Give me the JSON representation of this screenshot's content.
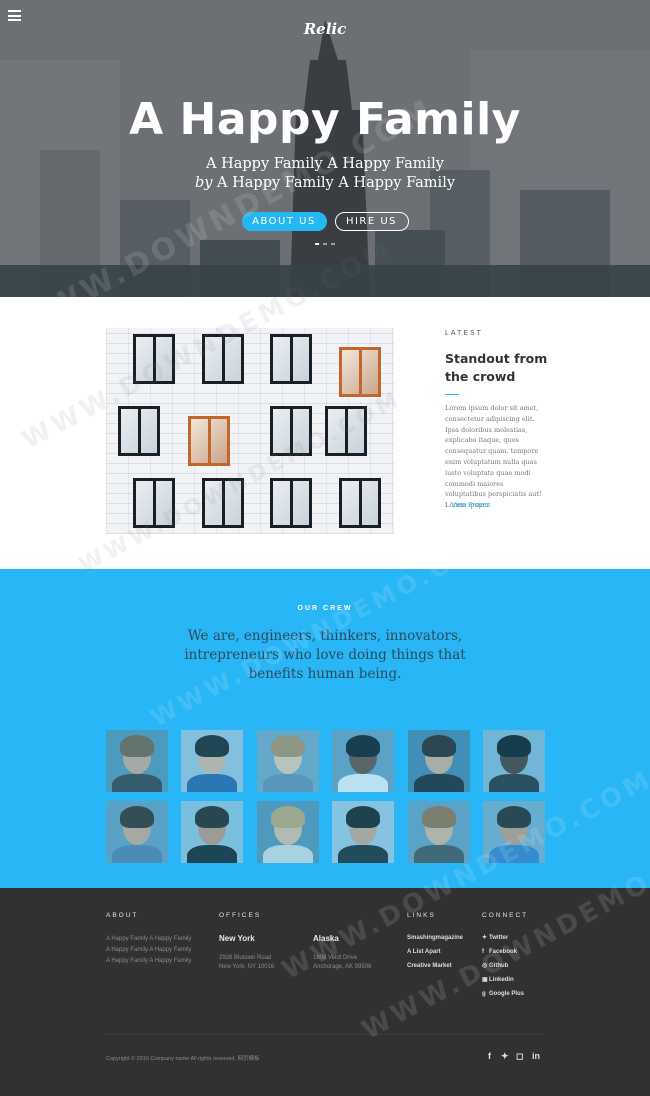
{
  "header": {
    "logo": "Relic",
    "menu_icon": "hamburger-menu-icon"
  },
  "hero": {
    "title": "A Happy Family",
    "subtitle_line1": "A Happy Family A Happy Family",
    "subtitle_line2_prefix": "by",
    "subtitle_line2": " A Happy Family A Happy Family",
    "primary_button": "ABOUT US",
    "secondary_button": "HIRE US"
  },
  "latest": {
    "kicker": "LATEST",
    "title": "Standout from the crowd",
    "body": "Lorem ipsum dolor sit amet, consectetur adipiscing elit. Ipsa doloribus molestias, explicabo itaque, quos consequatur quam. tempore enim voluptatum nulla quas iusto voluptate quae modi commodi maiores voluptatibus perspiciatis aut! Lorem ipsum.",
    "link": "View Project",
    "link_icon": "chevron-right-icon"
  },
  "crew": {
    "kicker": "OUR CREW",
    "text": "We are, engineers, thinkers, innovators, intrepreneurs who love doing things that benefits human being.",
    "members": [
      "member-1",
      "member-2",
      "member-3",
      "member-4",
      "member-5",
      "member-6",
      "member-7",
      "member-8",
      "member-9",
      "member-10",
      "member-11",
      "member-12"
    ]
  },
  "footer": {
    "about": {
      "heading": "ABOUT",
      "lines": [
        "A Happy Family A Happy Family",
        "A Happy Family A Happy Family",
        "A Happy Family A Happy Family"
      ]
    },
    "offices": {
      "heading": "OFFICES",
      "locations": [
        {
          "city": "New York",
          "line1": "2926 Blutown Road",
          "line2": "New York, NY 10016"
        },
        {
          "city": "Alaska",
          "line1": "1808 Veldt Drive",
          "line2": "Anchorage, AK 99508"
        }
      ]
    },
    "links": {
      "heading": "LINKS",
      "items": [
        "Smashingmagazine",
        "A List Apart",
        "Creative Market"
      ]
    },
    "connect": {
      "heading": "CONNECT",
      "items": [
        {
          "icon": "twitter-icon",
          "glyph": "🐦",
          "label": "Twitter"
        },
        {
          "icon": "facebook-icon",
          "glyph": "f",
          "label": "Facebook"
        },
        {
          "icon": "github-icon",
          "glyph": "◎",
          "label": "Github"
        },
        {
          "icon": "linkedin-icon",
          "glyph": "▣",
          "label": "Linkedin"
        },
        {
          "icon": "google-plus-icon",
          "glyph": "g",
          "label": "Google Plus"
        }
      ]
    },
    "copyright": "Copyright © 2016 Company name All rights reserved.",
    "copyright_tag": "网页模板",
    "social_glyphs": [
      "f",
      "🐦",
      "◻",
      "in"
    ]
  },
  "watermark": "WWW.DOWNDEMO.COM",
  "colors": {
    "accent": "#29b6f6",
    "footer_bg": "#313131",
    "window_orange": "#c4652b"
  }
}
